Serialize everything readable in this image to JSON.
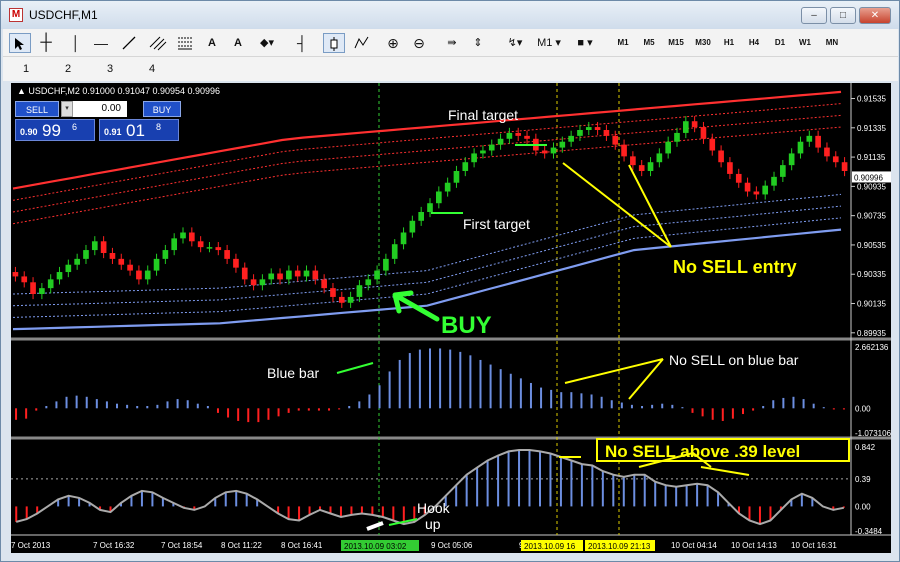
{
  "window": {
    "title": "USDCHF,M1",
    "icon": "app-logo-icon",
    "minimize": "–",
    "maximize": "□",
    "close": "✕"
  },
  "toolbar": {
    "text_tool": "A",
    "label_tool": "A",
    "timeframes": [
      "M1",
      "M5",
      "M15",
      "M30",
      "H1",
      "H4",
      "D1",
      "W1",
      "MN"
    ],
    "period_selector": "M1",
    "icons": [
      "cursor-icon",
      "crosshair-icon",
      "vertical-line-icon",
      "horizontal-line-icon",
      "trendline-icon",
      "channel-icon",
      "fibonacci-icon",
      "text-icon",
      "label-icon",
      "shapes-icon",
      "arrow-up-icon",
      "chart-mode-icon",
      "indicator-icon",
      "zoom-in-icon",
      "zoom-out-icon",
      "scroll-icon",
      "autoscroll-icon",
      "period-icon",
      "template-icon"
    ]
  },
  "subbar": {
    "items": [
      "1",
      "2",
      "3",
      "4"
    ]
  },
  "trade_panel": {
    "sell_label": "SELL",
    "buy_label": "BUY",
    "lot": "0.00",
    "sell_price_prefix": "0.90",
    "sell_price_big": "99",
    "sell_price_sup": "6",
    "buy_price_prefix": "0.91",
    "buy_price_big": "01",
    "buy_price_sup": "8"
  },
  "chart_header": "▲ USDCHF,M2  0.91000 0.91047 0.90954 0.90996",
  "colors": {
    "bull": "#22cc22",
    "bear": "#ff2020",
    "blue": "#6c8ee0",
    "annot_yellow": "#ffff00",
    "annot_green": "#33ff33",
    "upper_band": "#ff3030",
    "lower_band": "#7f9cf0"
  },
  "chart_data": [
    {
      "type": "candlestick",
      "title": "USDCHF,M2",
      "y_axis_ticks": [
        "0.91535",
        "0.91335",
        "0.91135",
        "0.90935",
        "0.90735",
        "0.90535",
        "0.90335",
        "0.90135",
        "0.89935"
      ],
      "current_price": "0.90996",
      "ylim": [
        0.8992,
        0.916
      ],
      "closes": [
        0.9032,
        0.9028,
        0.902,
        0.9024,
        0.903,
        0.9035,
        0.904,
        0.9044,
        0.905,
        0.9056,
        0.9048,
        0.9044,
        0.904,
        0.9036,
        0.903,
        0.9036,
        0.9044,
        0.905,
        0.9058,
        0.9062,
        0.9056,
        0.9052,
        0.9052,
        0.905,
        0.9044,
        0.9038,
        0.903,
        0.9026,
        0.903,
        0.9034,
        0.903,
        0.9036,
        0.9032,
        0.9036,
        0.903,
        0.9024,
        0.9018,
        0.9014,
        0.9018,
        0.9026,
        0.903,
        0.9036,
        0.9044,
        0.9054,
        0.9062,
        0.907,
        0.9076,
        0.9082,
        0.909,
        0.9096,
        0.9104,
        0.911,
        0.9116,
        0.9118,
        0.9122,
        0.9126,
        0.913,
        0.9128,
        0.9126,
        0.9118,
        0.9116,
        0.912,
        0.9124,
        0.9128,
        0.9132,
        0.9134,
        0.9132,
        0.9128,
        0.9122,
        0.9114,
        0.9108,
        0.9104,
        0.911,
        0.9116,
        0.9124,
        0.913,
        0.9138,
        0.9134,
        0.9126,
        0.9118,
        0.911,
        0.9102,
        0.9096,
        0.909,
        0.9088,
        0.9094,
        0.91,
        0.9108,
        0.9116,
        0.9124,
        0.9128,
        0.912,
        0.9114,
        0.911,
        0.9104
      ],
      "upper_band": [
        0.9092,
        0.9126,
        0.9142,
        0.9158
      ],
      "lower_band": [
        0.8996,
        0.9,
        0.9012,
        0.905,
        0.9064
      ]
    },
    {
      "type": "bar",
      "title": "histogram",
      "y_axis_ticks": [
        "2.662136",
        "0.00",
        "-1.073106"
      ],
      "ylim": [
        -1.073106,
        2.662136
      ],
      "values": [
        -0.5,
        -0.45,
        -0.1,
        0.1,
        0.3,
        0.5,
        0.55,
        0.5,
        0.4,
        0.3,
        0.2,
        0.15,
        0.1,
        0.1,
        0.15,
        0.3,
        0.4,
        0.35,
        0.2,
        0.1,
        -0.2,
        -0.4,
        -0.55,
        -0.6,
        -0.6,
        -0.5,
        -0.35,
        -0.2,
        -0.1,
        -0.1,
        -0.1,
        -0.1,
        -0.05,
        0.1,
        0.3,
        0.6,
        1.0,
        1.6,
        2.1,
        2.4,
        2.55,
        2.6,
        2.6,
        2.55,
        2.45,
        2.3,
        2.1,
        1.9,
        1.7,
        1.5,
        1.3,
        1.1,
        0.9,
        0.8,
        0.7,
        0.7,
        0.65,
        0.6,
        0.5,
        0.35,
        0.25,
        0.15,
        0.1,
        0.15,
        0.2,
        0.15,
        0.05,
        -0.2,
        -0.35,
        -0.5,
        -0.55,
        -0.45,
        -0.25,
        -0.1,
        0.1,
        0.35,
        0.45,
        0.5,
        0.4,
        0.2,
        0.05,
        -0.05,
        -0.05
      ]
    },
    {
      "type": "bar",
      "title": "oscillator",
      "y_axis_ticks": [
        "0.842",
        "0.39",
        "0.00",
        "-0.3484"
      ],
      "ylim": [
        -0.3484,
        0.842
      ],
      "level": 0.39,
      "values": [
        -0.22,
        -0.18,
        -0.1,
        0.0,
        0.1,
        0.15,
        0.12,
        0.05,
        -0.05,
        -0.08,
        0.05,
        0.15,
        0.22,
        0.2,
        0.12,
        0.05,
        -0.02,
        -0.05,
        0.0,
        0.12,
        0.2,
        0.22,
        0.18,
        0.1,
        0.0,
        -0.1,
        -0.18,
        -0.2,
        -0.12,
        -0.05,
        -0.1,
        -0.15,
        -0.12,
        -0.1,
        -0.12,
        -0.15,
        -0.2,
        -0.25,
        -0.22,
        -0.12,
        0.0,
        0.15,
        0.3,
        0.45,
        0.55,
        0.65,
        0.72,
        0.78,
        0.8,
        0.8,
        0.78,
        0.75,
        0.7,
        0.65,
        0.6,
        0.58,
        0.5,
        0.45,
        0.42,
        0.45,
        0.45,
        0.35,
        0.3,
        0.28,
        0.3,
        0.32,
        0.3,
        0.2,
        0.05,
        -0.1,
        -0.2,
        -0.25,
        -0.2,
        -0.05,
        0.1,
        0.18,
        0.12,
        0.0,
        -0.05,
        -0.02
      ]
    }
  ],
  "time_labels": [
    "7 Oct 2013",
    "7 Oct 16:32",
    "7 Oct 18:54",
    "8 Oct 11:22",
    "8 Oct 16:41",
    "8 Oct 1",
    "9 Oct 05:06",
    "9 Oct 1",
    "10 Oct 04:14",
    "10 Oct 14:13",
    "10 Oct 16:31"
  ],
  "time_highlights": [
    "2013.10.09 03:02",
    "2013.10.09 16",
    "2013.10.09 21:13"
  ],
  "annotations": {
    "final_target": "Final target",
    "first_target": "First target",
    "no_sell_entry": "No SELL entry",
    "buy": "BUY",
    "blue_bar": "Blue bar",
    "no_sell_blue": "No SELL on blue bar",
    "no_sell_level": "No SELL above .39 level",
    "hook": "Hook",
    "hook_up": "up"
  }
}
